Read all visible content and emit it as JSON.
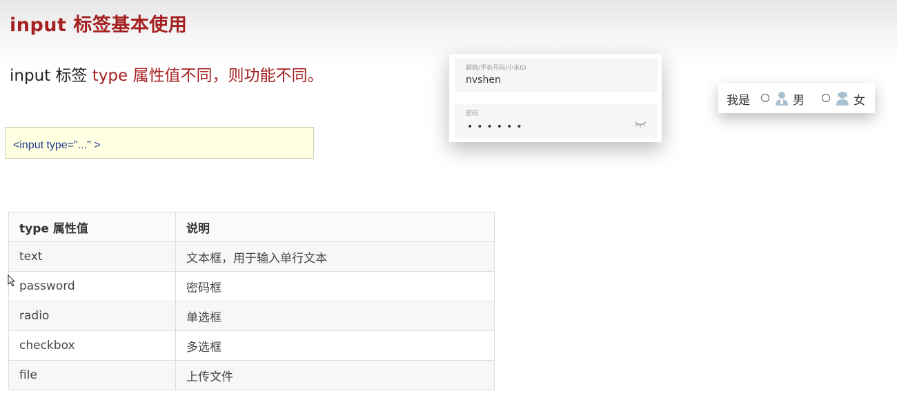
{
  "slide": {
    "title": "input 标签基本使用",
    "subtitle_pre": "input 标签 ",
    "subtitle_kw": "type 属性值不同，则功能不同。"
  },
  "code": {
    "text": "<input type=\"...\" >"
  },
  "login": {
    "account_label": "邮箱/手机号码/小米ID",
    "account_value": "nvshen",
    "password_label": "密码",
    "password_dots": "••••••",
    "eye_icon": "eye-closed-icon"
  },
  "gender": {
    "label": "我是",
    "option_male": "男",
    "option_female": "女",
    "male_icon": "male-person-icon",
    "female_icon": "female-person-icon",
    "icon_color": "#a9c0d0"
  },
  "table": {
    "headers": [
      "type 属性值",
      "说明"
    ],
    "rows": [
      [
        "text",
        "文本框，用于输入单行文本"
      ],
      [
        "password",
        "密码框"
      ],
      [
        "radio",
        "单选框"
      ],
      [
        "checkbox",
        "多选框"
      ],
      [
        "file",
        "上传文件"
      ]
    ]
  },
  "colors": {
    "accent": "#a52020",
    "code_bg": "#ffffe2",
    "code_text": "#1e3a8a"
  }
}
